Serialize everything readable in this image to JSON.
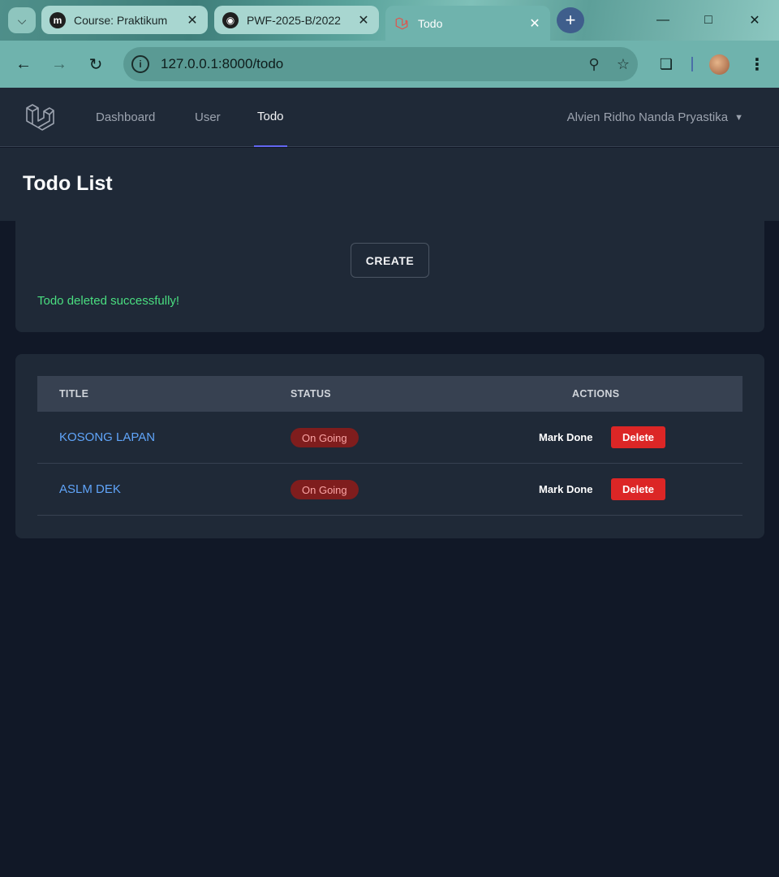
{
  "browser": {
    "tabs": [
      {
        "title": "Course: Praktikum",
        "favicon": "m-icon",
        "active": false
      },
      {
        "title": "PWF-2025-B/2022",
        "favicon": "github-icon",
        "active": false
      },
      {
        "title": "Todo",
        "favicon": "laravel-icon",
        "active": true
      }
    ],
    "url": "127.0.0.1:8000/todo"
  },
  "nav": {
    "links": [
      {
        "label": "Dashboard",
        "active": false
      },
      {
        "label": "User",
        "active": false
      },
      {
        "label": "Todo",
        "active": true
      }
    ],
    "user_name": "Alvien Ridho Nanda Pryastika"
  },
  "page": {
    "title": "Todo List",
    "create_label": "CREATE",
    "flash_message": "Todo deleted successfully!"
  },
  "table": {
    "headers": [
      "TITLE",
      "STATUS",
      "ACTIONS"
    ],
    "rows": [
      {
        "title": "KOSONG LAPAN",
        "status": "On Going",
        "mark_done": "Mark Done",
        "delete": "Delete"
      },
      {
        "title": "ASLM DEK",
        "status": "On Going",
        "mark_done": "Mark Done",
        "delete": "Delete"
      }
    ]
  },
  "colors": {
    "accent": "#6366f1",
    "success_text": "#4ade80",
    "danger": "#dc2626",
    "link": "#60a5fa",
    "badge_bg": "#7f1d1d"
  }
}
